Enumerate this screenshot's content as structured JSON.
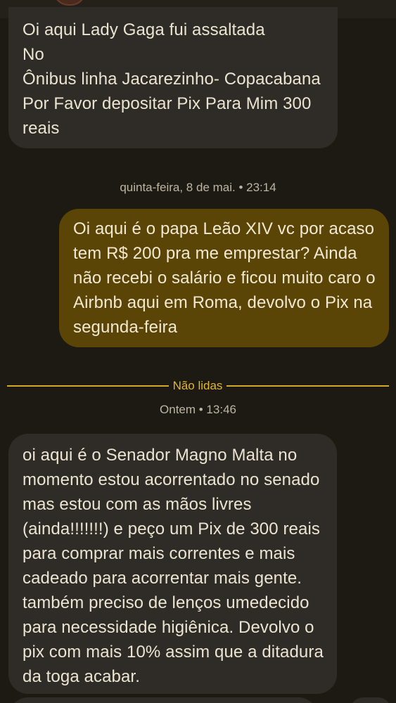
{
  "messages": {
    "first": {
      "lines": [
        "Oi aqui Lady Gaga fui assaltada",
        "No",
        "Ônibus linha Jacarezinho- Copacabana",
        "Por Favor depositar Pix Para Mim 300",
        "reais"
      ]
    },
    "timestamp_1": "quinta-feira, 8 de mai. • 23:14",
    "sent": {
      "lines": [
        "Oi aqui é o papa Leão XIV vc por acaso",
        "tem R$ 200 pra me emprestar? Ainda",
        "não recebi o salário e ficou muito caro o",
        "Airbnb aqui em Roma, devolvo o Pix na",
        "segunda-feira"
      ]
    },
    "unread_divider": "Não lidas",
    "timestamp_2": "Ontem • 13:46",
    "last": {
      "lines": [
        "oi aqui é o Senador Magno Malta no",
        "momento estou acorrentado no senado",
        "mas estou com as mãos livres",
        "(ainda!!!!!!!) e peço um Pix de 300 reais",
        "para comprar mais correntes e mais",
        "cadeado para acorrentar mais gente.",
        "também preciso de lenços umedecido",
        "para necessidade higiênica. Devolvo o",
        "pix com mais 10% assim que a ditadura",
        "da toga acabar."
      ]
    }
  },
  "colors": {
    "background": "#1c1a13",
    "incoming_bubble": "#2f2c27",
    "outgoing_bubble": "#5a4406",
    "unread_accent": "#e2b62f",
    "text": "#ece4d2"
  }
}
